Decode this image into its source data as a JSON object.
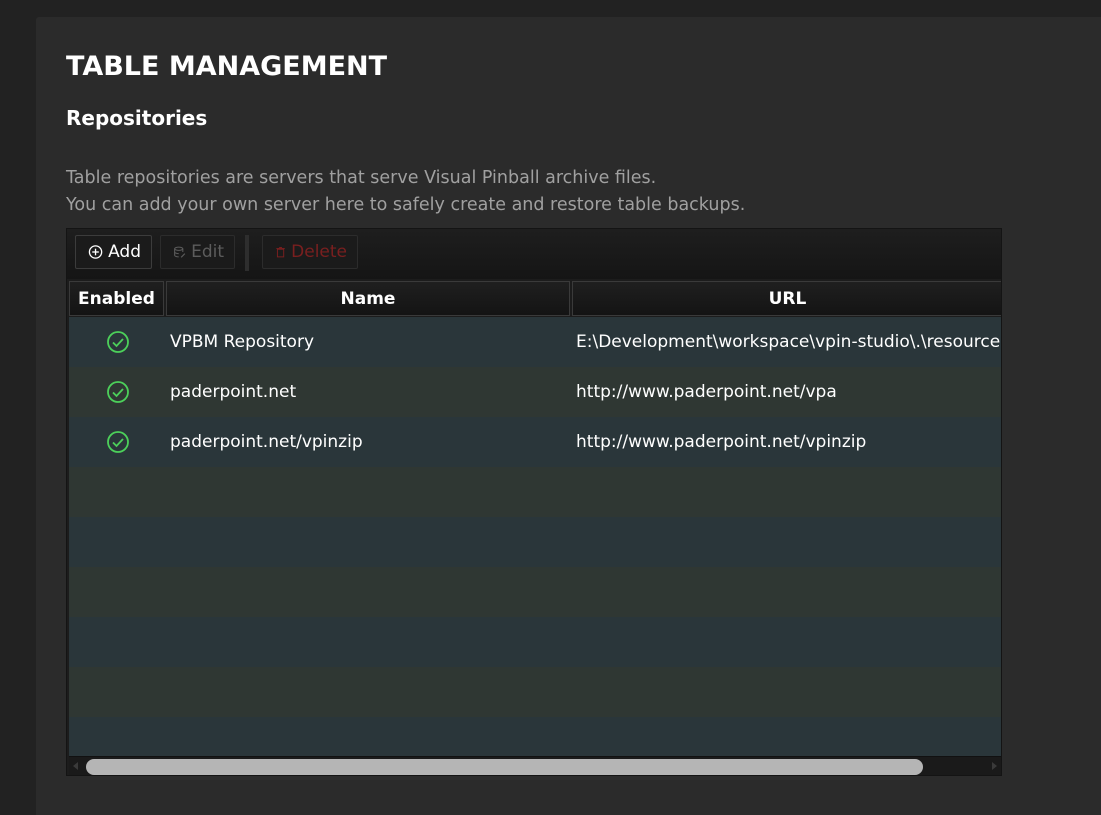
{
  "page": {
    "title": "TABLE MANAGEMENT",
    "section_title": "Repositories",
    "description_line1": "Table repositories are servers that serve Visual Pinball archive files.",
    "description_line2": "You can add your own server here to safely create and restore table backups."
  },
  "toolbar": {
    "add_label": "Add",
    "add_icon": "plus-circle-icon",
    "edit_label": "Edit",
    "edit_icon": "database-edit-icon",
    "delete_label": "Delete",
    "delete_icon": "trash-icon",
    "delete_color": "#7a1f1f"
  },
  "table": {
    "columns": [
      "Enabled",
      "Name",
      "URL"
    ],
    "rows": [
      {
        "enabled": true,
        "name": "VPBM Repository",
        "url": "E:\\Development\\workspace\\vpin-studio\\.\\resources\\archives"
      },
      {
        "enabled": true,
        "name": "paderpoint.net",
        "url": "http://www.paderpoint.net/vpa"
      },
      {
        "enabled": true,
        "name": "paderpoint.net/vpinzip",
        "url": "http://www.paderpoint.net/vpinzip"
      }
    ],
    "enabled_icon": "check-circle-icon",
    "enabled_color": "#4cd05a",
    "row_colors": [
      "#2a363a",
      "#2f3733"
    ]
  }
}
